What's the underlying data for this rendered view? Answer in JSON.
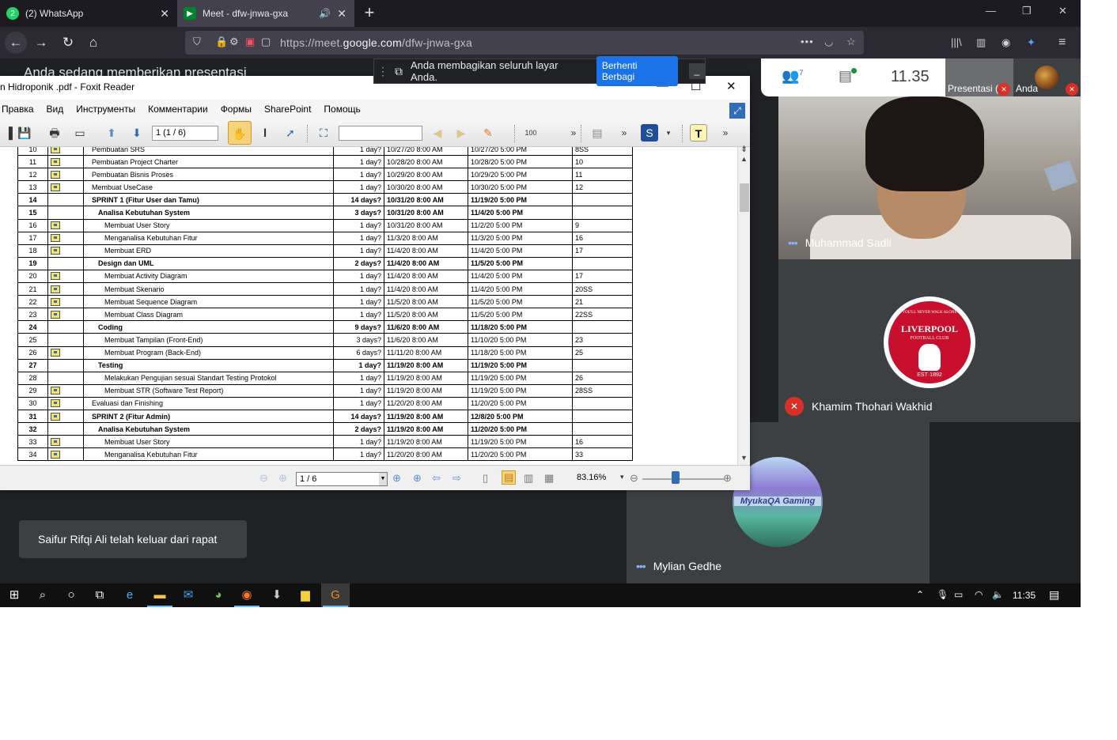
{
  "browser": {
    "tabs": [
      {
        "label": "(2) WhatsApp",
        "badge": "2"
      },
      {
        "label": "Meet - dfw-jnwa-gxa"
      }
    ],
    "url_prefix": "https://meet.",
    "url_domain": "google.com",
    "url_path": "/dfw-jnwa-gxa"
  },
  "meet": {
    "present_banner": "Anda sedang memberikan presentasi",
    "share_text": "Anda membagikan seluruh layar Anda.",
    "stop_share_label": "Berhenti Berbagi",
    "people_count": "7",
    "clock": "11.35",
    "thumb_presentation_label": "Presentasi (",
    "thumb_self_label": "Anda",
    "participants": [
      {
        "name": "Muhammad Sadli"
      },
      {
        "name": "Khamim Thohari Wakhid",
        "avatar_text": "LIVERPOOL",
        "avatar_sub": "FOOTBALL CLUB",
        "avatar_top": "YOU'LL NEVER WALK ALONE",
        "avatar_est": "EST·1892"
      },
      {
        "name": "Mylian Gedhe",
        "avatar_text": "MyukaQA Gaming"
      }
    ],
    "toast": "Saifur Rifqi Ali telah keluar dari rapat"
  },
  "foxit": {
    "title": "n Hidroponik .pdf - Foxit Reader",
    "menu": [
      "Правка",
      "Вид",
      "Инструменты",
      "Комментарии",
      "Формы",
      "SharePoint",
      "Помощь"
    ],
    "page_field": "1 (1 / 6)",
    "status_page": "1 / 6",
    "zoom": "83.16%",
    "table": [
      {
        "id": "10",
        "icon": true,
        "name": "Pembuatan SRS",
        "dur": "1 day?",
        "start": "10/27/20 8:00 AM",
        "finish": "10/27/20 5:00 PM",
        "pred": "8SS",
        "bold": false,
        "indent": 1
      },
      {
        "id": "11",
        "icon": true,
        "name": "Pembuatan Project Charter",
        "dur": "1 day?",
        "start": "10/28/20 8:00 AM",
        "finish": "10/28/20 5:00 PM",
        "pred": "10",
        "bold": false,
        "indent": 1
      },
      {
        "id": "12",
        "icon": true,
        "name": "Pembuatan Bisnis Proses",
        "dur": "1 day?",
        "start": "10/29/20 8:00 AM",
        "finish": "10/29/20 5:00 PM",
        "pred": "11",
        "bold": false,
        "indent": 1
      },
      {
        "id": "13",
        "icon": true,
        "name": "Membuat UseCase",
        "dur": "1 day?",
        "start": "10/30/20 8:00 AM",
        "finish": "10/30/20 5:00 PM",
        "pred": "12",
        "bold": false,
        "indent": 1
      },
      {
        "id": "14",
        "icon": false,
        "name": "SPRINT 1  (Fitur User dan Tamu)",
        "dur": "14 days?",
        "start": "10/31/20 8:00 AM",
        "finish": "11/19/20 5:00 PM",
        "pred": "",
        "bold": true,
        "indent": 1
      },
      {
        "id": "15",
        "icon": false,
        "name": "Analisa Kebutuhan System",
        "dur": "3 days?",
        "start": "10/31/20 8:00 AM",
        "finish": "11/4/20 5:00 PM",
        "pred": "",
        "bold": true,
        "indent": 2
      },
      {
        "id": "16",
        "icon": true,
        "name": "Membuat User Story",
        "dur": "1 day?",
        "start": "10/31/20 8:00 AM",
        "finish": "11/2/20 5:00 PM",
        "pred": "9",
        "bold": false,
        "indent": 3
      },
      {
        "id": "17",
        "icon": true,
        "name": "Menganalisa Kebutuhan Fitur",
        "dur": "1 day?",
        "start": "11/3/20 8:00 AM",
        "finish": "11/3/20 5:00 PM",
        "pred": "16",
        "bold": false,
        "indent": 3
      },
      {
        "id": "18",
        "icon": true,
        "name": "Membuat ERD",
        "dur": "1 day?",
        "start": "11/4/20 8:00 AM",
        "finish": "11/4/20 5:00 PM",
        "pred": "17",
        "bold": false,
        "indent": 3
      },
      {
        "id": "19",
        "icon": false,
        "name": "Design dan UML",
        "dur": "2 days?",
        "start": "11/4/20 8:00 AM",
        "finish": "11/5/20 5:00 PM",
        "pred": "",
        "bold": true,
        "indent": 2
      },
      {
        "id": "20",
        "icon": true,
        "name": "Membuat Activity Diagram",
        "dur": "1 day?",
        "start": "11/4/20 8:00 AM",
        "finish": "11/4/20 5:00 PM",
        "pred": "17",
        "bold": false,
        "indent": 3
      },
      {
        "id": "21",
        "icon": true,
        "name": "Membuat Skenario",
        "dur": "1 day?",
        "start": "11/4/20 8:00 AM",
        "finish": "11/4/20 5:00 PM",
        "pred": "20SS",
        "bold": false,
        "indent": 3
      },
      {
        "id": "22",
        "icon": true,
        "name": "Membuat Sequence Diagram",
        "dur": "1 day?",
        "start": "11/5/20 8:00 AM",
        "finish": "11/5/20 5:00 PM",
        "pred": "21",
        "bold": false,
        "indent": 3
      },
      {
        "id": "23",
        "icon": true,
        "name": "Membuat Class Diagram",
        "dur": "1 day?",
        "start": "11/5/20 8:00 AM",
        "finish": "11/5/20 5:00 PM",
        "pred": "22SS",
        "bold": false,
        "indent": 3
      },
      {
        "id": "24",
        "icon": false,
        "name": "Coding",
        "dur": "9 days?",
        "start": "11/6/20 8:00 AM",
        "finish": "11/18/20 5:00 PM",
        "pred": "",
        "bold": true,
        "indent": 2
      },
      {
        "id": "25",
        "icon": false,
        "name": "Membuat Tampilan (Front-End)",
        "dur": "3 days?",
        "start": "11/6/20 8:00 AM",
        "finish": "11/10/20 5:00 PM",
        "pred": "23",
        "bold": false,
        "indent": 3
      },
      {
        "id": "26",
        "icon": true,
        "name": "Membuat Program (Back-End)",
        "dur": "6 days?",
        "start": "11/11/20 8:00 AM",
        "finish": "11/18/20 5:00 PM",
        "pred": "25",
        "bold": false,
        "indent": 3
      },
      {
        "id": "27",
        "icon": false,
        "name": "Testing",
        "dur": "1 day?",
        "start": "11/19/20 8:00 AM",
        "finish": "11/19/20 5:00 PM",
        "pred": "",
        "bold": true,
        "indent": 2
      },
      {
        "id": "28",
        "icon": false,
        "name": "Melakukan Pengujian sesuai Standart Testing Protokol",
        "dur": "1 day?",
        "start": "11/19/20 8:00 AM",
        "finish": "11/19/20 5:00 PM",
        "pred": "26",
        "bold": false,
        "indent": 3
      },
      {
        "id": "29",
        "icon": true,
        "name": "Membuat STR (Software Test Report)",
        "dur": "1 day?",
        "start": "11/19/20 8:00 AM",
        "finish": "11/19/20 5:00 PM",
        "pred": "28SS",
        "bold": false,
        "indent": 3
      },
      {
        "id": "30",
        "icon": true,
        "name": "Evaluasi dan Finishing",
        "dur": "1 day?",
        "start": "11/20/20 8:00 AM",
        "finish": "11/20/20 5:00 PM",
        "pred": "",
        "bold": false,
        "indent": 1
      },
      {
        "id": "31",
        "icon": true,
        "name": "SPRINT 2 (Fitur Admin)",
        "dur": "14 days?",
        "start": "11/19/20 8:00 AM",
        "finish": "12/8/20 5:00 PM",
        "pred": "",
        "bold": true,
        "indent": 1
      },
      {
        "id": "32",
        "icon": false,
        "name": "Analisa Kebutuhan System",
        "dur": "2 days?",
        "start": "11/19/20 8:00 AM",
        "finish": "11/20/20 5:00 PM",
        "pred": "",
        "bold": true,
        "indent": 2
      },
      {
        "id": "33",
        "icon": true,
        "name": "Membuat User Story",
        "dur": "1 day?",
        "start": "11/19/20 8:00 AM",
        "finish": "11/19/20 5:00 PM",
        "pred": "16",
        "bold": false,
        "indent": 3
      },
      {
        "id": "34",
        "icon": true,
        "name": "Menganalisa Kebutuhan Fitur",
        "dur": "1 day?",
        "start": "11/20/20 8:00 AM",
        "finish": "11/20/20 5:00 PM",
        "pred": "33",
        "bold": false,
        "indent": 3
      }
    ]
  },
  "taskbar": {
    "time": "11:35"
  },
  "colors": {
    "meet_bg": "#202124",
    "accent_blue": "#1a73e8",
    "mic_off_red": "#d93025",
    "lfc_red": "#c8102e"
  }
}
